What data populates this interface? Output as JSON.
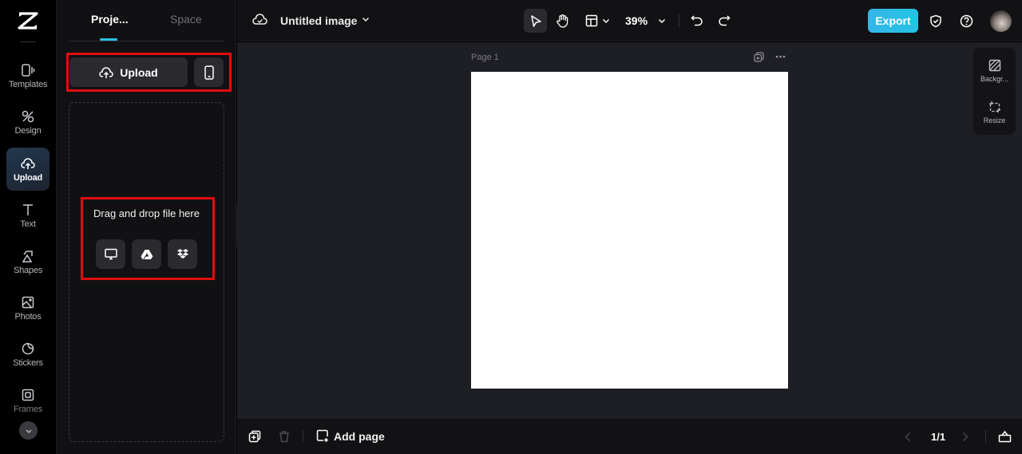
{
  "rail": {
    "items": [
      {
        "label": "Templates",
        "icon": "templates-icon"
      },
      {
        "label": "Design",
        "icon": "design-icon"
      },
      {
        "label": "Upload",
        "icon": "upload-cloud-icon",
        "active": true
      },
      {
        "label": "Text",
        "icon": "text-icon"
      },
      {
        "label": "Shapes",
        "icon": "shapes-icon"
      },
      {
        "label": "Photos",
        "icon": "photos-icon"
      },
      {
        "label": "Stickers",
        "icon": "stickers-icon"
      },
      {
        "label": "Frames",
        "icon": "frames-icon"
      }
    ],
    "more_icon": "chevron-down-icon"
  },
  "panel": {
    "tabs": [
      {
        "label": "Proje...",
        "active": true
      },
      {
        "label": "Space",
        "active": false
      }
    ],
    "upload_label": "Upload",
    "dropzone_text": "Drag and drop file here",
    "sources": [
      "computer-icon",
      "google-drive-icon",
      "dropbox-icon"
    ]
  },
  "topbar": {
    "title": "Untitled image",
    "zoom": "39%",
    "export_label": "Export"
  },
  "canvas": {
    "page_label": "Page 1",
    "page_color": "#ffffff"
  },
  "right_tools": [
    {
      "label": "Backgr..."
    },
    {
      "label": "Resize"
    }
  ],
  "bottombar": {
    "add_page_label": "Add page",
    "page_count": "1/1"
  },
  "colors": {
    "accent": "#2bc3e0",
    "export": "#22c4e3",
    "highlight": "#e10c0c"
  }
}
